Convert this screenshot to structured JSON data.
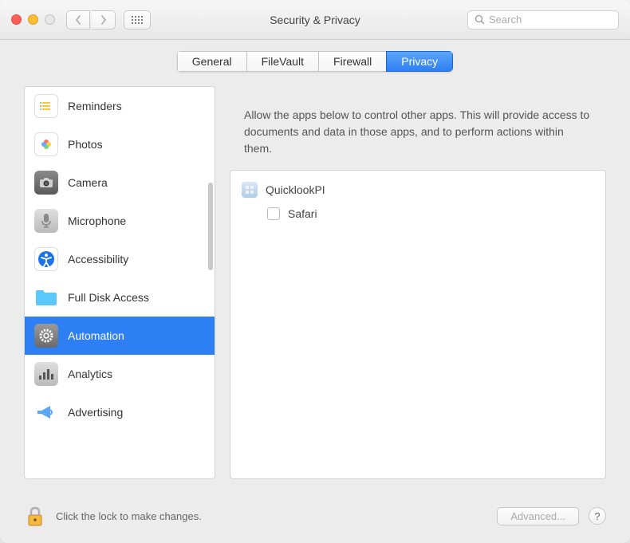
{
  "window": {
    "title": "Security & Privacy"
  },
  "search": {
    "placeholder": "Search"
  },
  "tabs": [
    {
      "label": "General",
      "active": false
    },
    {
      "label": "FileVault",
      "active": false
    },
    {
      "label": "Firewall",
      "active": false
    },
    {
      "label": "Privacy",
      "active": true
    }
  ],
  "sidebar": {
    "items": [
      {
        "label": "Reminders",
        "icon": "reminders"
      },
      {
        "label": "Photos",
        "icon": "photos"
      },
      {
        "label": "Camera",
        "icon": "camera"
      },
      {
        "label": "Microphone",
        "icon": "microphone"
      },
      {
        "label": "Accessibility",
        "icon": "accessibility"
      },
      {
        "label": "Full Disk Access",
        "icon": "folder"
      },
      {
        "label": "Automation",
        "icon": "gear",
        "selected": true
      },
      {
        "label": "Analytics",
        "icon": "analytics"
      },
      {
        "label": "Advertising",
        "icon": "megaphone"
      }
    ]
  },
  "detail": {
    "description": "Allow the apps below to control other apps. This will provide access to documents and data in those apps, and to perform actions within them.",
    "apps": [
      {
        "name": "QuicklookPI",
        "icon": "app-generic",
        "children": [
          {
            "name": "Safari",
            "checked": false
          }
        ]
      }
    ]
  },
  "footer": {
    "lock_text": "Click the lock to make changes.",
    "advanced_label": "Advanced...",
    "help_label": "?"
  }
}
